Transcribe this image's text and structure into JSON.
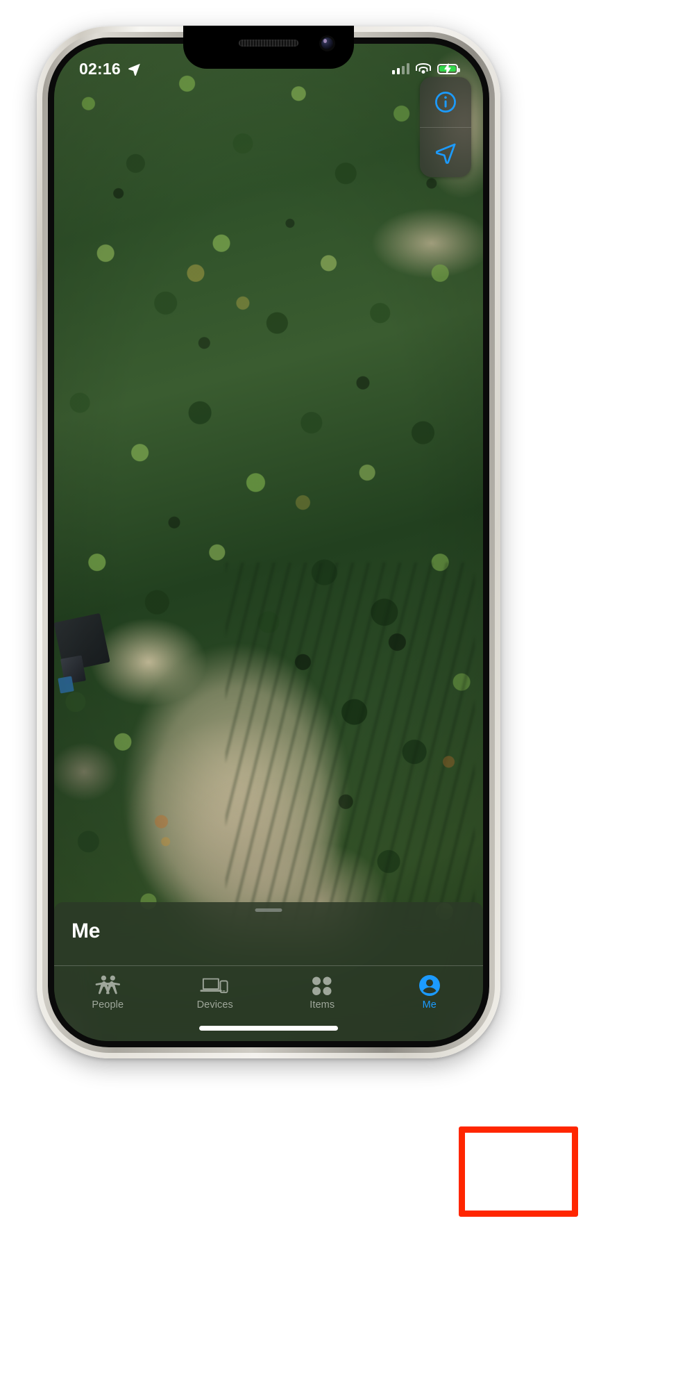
{
  "app": {
    "name": "Find My",
    "platform": "iOS"
  },
  "status_bar": {
    "time": "02:16",
    "location_arrow_icon": "location-arrow-filled-icon",
    "cellular_icon": "cellular-signal-icon",
    "cellular_bars_active": 2,
    "cellular_bars_total": 4,
    "wifi_icon": "wifi-icon",
    "battery_icon": "battery-charging-icon",
    "battery_charging": true,
    "battery_color": "#32d74b"
  },
  "map": {
    "type": "satellite",
    "controls": [
      {
        "name": "info-button",
        "icon": "info-circle-icon",
        "accent": "#1c9bff"
      },
      {
        "name": "locate-button",
        "icon": "location-arrow-outline-icon",
        "accent": "#1c9bff"
      }
    ]
  },
  "sheet": {
    "grabber": "sheet-grabber",
    "title": "Me"
  },
  "tabbar": {
    "tabs": [
      {
        "label": "People",
        "icon": "people-icon",
        "active": false
      },
      {
        "label": "Devices",
        "icon": "devices-icon",
        "active": false
      },
      {
        "label": "Items",
        "icon": "items-grid-icon",
        "active": false
      },
      {
        "label": "Me",
        "icon": "person-circle-icon",
        "active": true
      }
    ],
    "inactive_color": "#9fa79b",
    "active_color": "#1c9bff"
  },
  "annotation": {
    "highlight_color": "#ff2600",
    "target": "Me"
  },
  "colors": {
    "accent": "#1c9bff",
    "sheet_bg": "#2c3828",
    "frame": "#e9e6e0"
  }
}
